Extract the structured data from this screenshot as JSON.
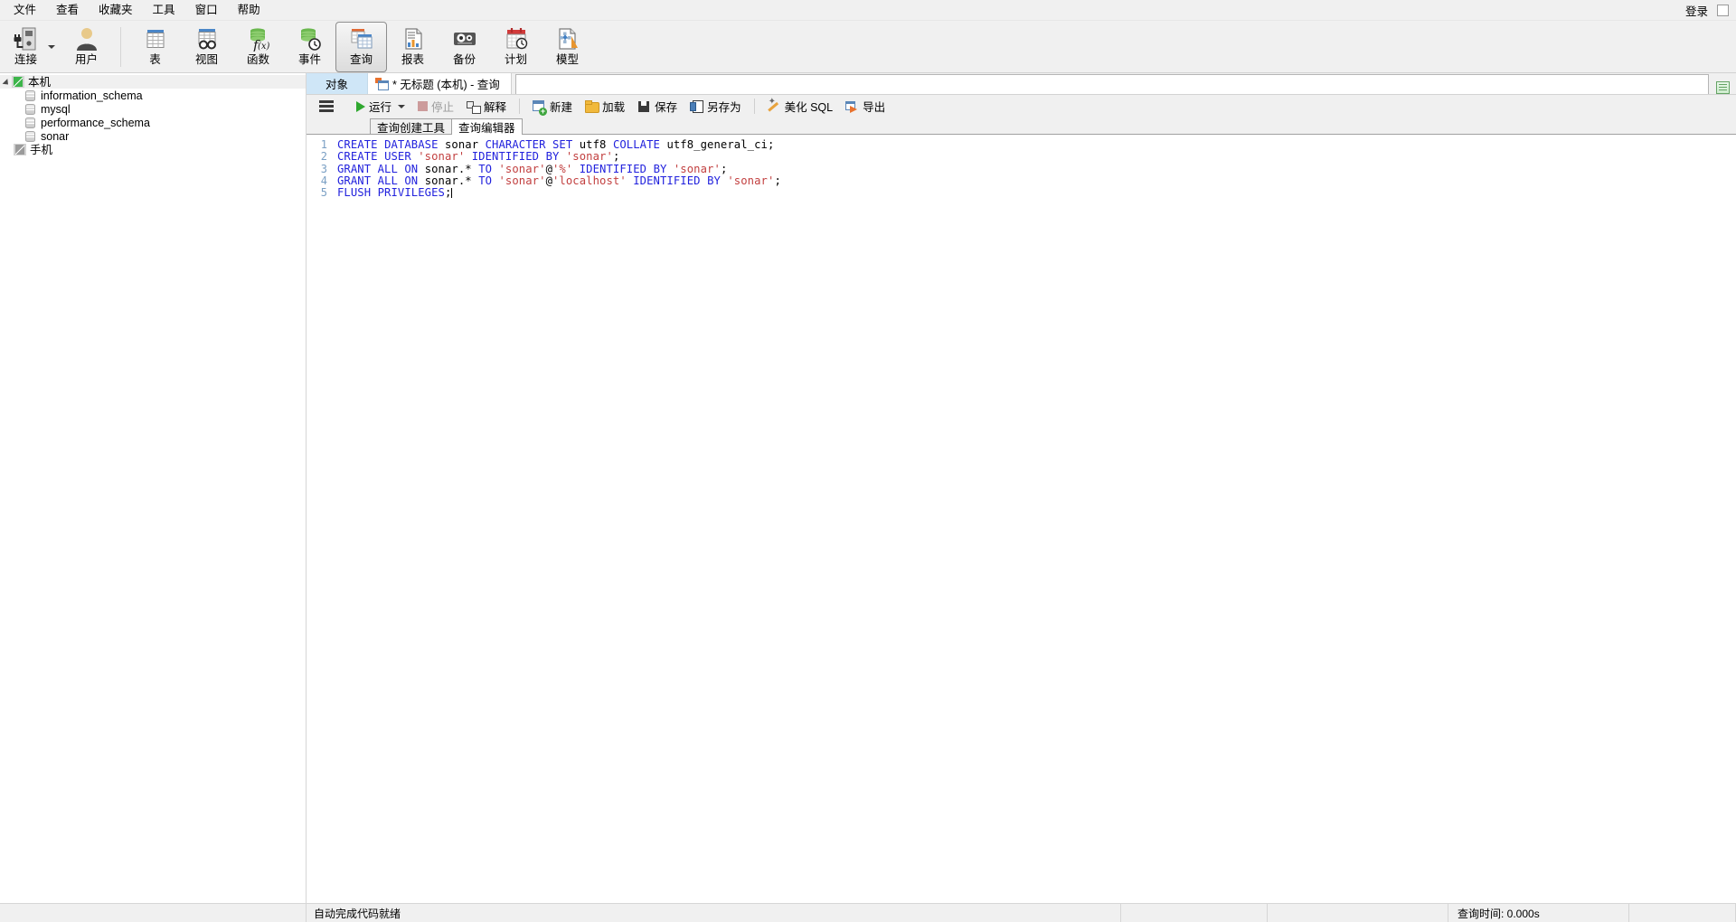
{
  "menu": {
    "items": [
      {
        "label": "文件",
        "name": "menu-file"
      },
      {
        "label": "查看",
        "name": "menu-view"
      },
      {
        "label": "收藏夹",
        "name": "menu-favorites"
      },
      {
        "label": "工具",
        "name": "menu-tools"
      },
      {
        "label": "窗口",
        "name": "menu-window"
      },
      {
        "label": "帮助",
        "name": "menu-help"
      }
    ],
    "login_label": "登录"
  },
  "ribbon": {
    "group1": [
      {
        "label": "连接",
        "icon": "connection-icon",
        "has_dropdown": true
      },
      {
        "label": "用户",
        "icon": "user-icon",
        "has_dropdown": false
      }
    ],
    "group2": [
      {
        "label": "表",
        "icon": "table-icon",
        "active": false
      },
      {
        "label": "视图",
        "icon": "view-icon",
        "active": false
      },
      {
        "label": "函数",
        "icon": "function-icon",
        "active": false
      },
      {
        "label": "事件",
        "icon": "event-icon",
        "active": false
      },
      {
        "label": "查询",
        "icon": "query-icon",
        "active": true
      },
      {
        "label": "报表",
        "icon": "report-icon",
        "active": false
      },
      {
        "label": "备份",
        "icon": "backup-icon",
        "active": false
      },
      {
        "label": "计划",
        "icon": "schedule-icon",
        "active": false
      },
      {
        "label": "模型",
        "icon": "model-icon",
        "active": false
      }
    ]
  },
  "sidebar": {
    "tree": [
      {
        "label": "本机",
        "type": "connection",
        "state": "connected",
        "level": 0,
        "expanded": true,
        "selected": true
      },
      {
        "label": "information_schema",
        "type": "database",
        "level": 1
      },
      {
        "label": "mysql",
        "type": "database",
        "level": 1
      },
      {
        "label": "performance_schema",
        "type": "database",
        "level": 1
      },
      {
        "label": "sonar",
        "type": "database",
        "level": 1
      },
      {
        "label": "手机",
        "type": "connection",
        "state": "disconnected",
        "level": 0,
        "expanded": false
      }
    ]
  },
  "tabs": {
    "object_tab": "对象",
    "query_tab": "* 无标题 (本机) - 查询"
  },
  "query_toolbar": {
    "menu_button": "list-menu-icon",
    "buttons": [
      {
        "label": "运行",
        "icon": "play-icon",
        "disabled": false,
        "dropdown": true
      },
      {
        "label": "停止",
        "icon": "stop-icon",
        "disabled": true,
        "dropdown": false
      },
      {
        "label": "解释",
        "icon": "explain-icon",
        "disabled": false,
        "dropdown": false
      },
      {
        "label": "新建",
        "icon": "new-query-icon",
        "disabled": false,
        "dropdown": false
      },
      {
        "label": "加载",
        "icon": "open-folder-icon",
        "disabled": false,
        "dropdown": false
      },
      {
        "label": "保存",
        "icon": "save-disk-icon",
        "disabled": false,
        "dropdown": false
      },
      {
        "label": "另存为",
        "icon": "save-as-icon",
        "disabled": false,
        "dropdown": false
      },
      {
        "label": "美化 SQL",
        "icon": "magic-wand-icon",
        "disabled": false,
        "dropdown": false
      },
      {
        "label": "导出",
        "icon": "export-icon",
        "disabled": false,
        "dropdown": false
      }
    ]
  },
  "subtabs": [
    {
      "label": "查询创建工具",
      "active": false
    },
    {
      "label": "查询编辑器",
      "active": true
    }
  ],
  "editor": {
    "line_numbers": [
      "1",
      "2",
      "3",
      "4",
      "5"
    ],
    "lines": [
      "CREATE DATABASE sonar CHARACTER SET utf8 COLLATE utf8_general_ci;",
      "CREATE USER 'sonar' IDENTIFIED BY 'sonar';",
      "GRANT ALL ON sonar.* TO 'sonar'@'%' IDENTIFIED BY 'sonar';",
      "GRANT ALL ON sonar.* TO 'sonar'@'localhost' IDENTIFIED BY 'sonar';",
      "FLUSH PRIVILEGES;"
    ],
    "tokens": [
      [
        {
          "t": "CREATE ",
          "c": "kw"
        },
        {
          "t": "DATABASE ",
          "c": "kw"
        },
        {
          "t": "sonar ",
          "c": "id"
        },
        {
          "t": "CHARACTER ",
          "c": "kw"
        },
        {
          "t": "SET ",
          "c": "kw"
        },
        {
          "t": "utf8 ",
          "c": "id"
        },
        {
          "t": "COLLATE ",
          "c": "kw"
        },
        {
          "t": "utf8_general_ci;",
          "c": "id"
        }
      ],
      [
        {
          "t": "CREATE ",
          "c": "kw"
        },
        {
          "t": "USER ",
          "c": "kw"
        },
        {
          "t": "'sonar' ",
          "c": "str"
        },
        {
          "t": "IDENTIFIED ",
          "c": "kw"
        },
        {
          "t": "BY ",
          "c": "kw"
        },
        {
          "t": "'sonar'",
          "c": "str"
        },
        {
          "t": ";",
          "c": "pun"
        }
      ],
      [
        {
          "t": "GRANT ",
          "c": "kw"
        },
        {
          "t": "ALL ",
          "c": "kw"
        },
        {
          "t": "ON ",
          "c": "kw"
        },
        {
          "t": "sonar.* ",
          "c": "id"
        },
        {
          "t": "TO ",
          "c": "kw"
        },
        {
          "t": "'sonar'",
          "c": "str"
        },
        {
          "t": "@",
          "c": "pun"
        },
        {
          "t": "'%' ",
          "c": "str"
        },
        {
          "t": "IDENTIFIED ",
          "c": "kw"
        },
        {
          "t": "BY ",
          "c": "kw"
        },
        {
          "t": "'sonar'",
          "c": "str"
        },
        {
          "t": ";",
          "c": "pun"
        }
      ],
      [
        {
          "t": "GRANT ",
          "c": "kw"
        },
        {
          "t": "ALL ",
          "c": "kw"
        },
        {
          "t": "ON ",
          "c": "kw"
        },
        {
          "t": "sonar.* ",
          "c": "id"
        },
        {
          "t": "TO ",
          "c": "kw"
        },
        {
          "t": "'sonar'",
          "c": "str"
        },
        {
          "t": "@",
          "c": "pun"
        },
        {
          "t": "'localhost' ",
          "c": "str"
        },
        {
          "t": "IDENTIFIED ",
          "c": "kw"
        },
        {
          "t": "BY ",
          "c": "kw"
        },
        {
          "t": "'sonar'",
          "c": "str"
        },
        {
          "t": ";",
          "c": "pun"
        }
      ],
      [
        {
          "t": "FLUSH ",
          "c": "kw"
        },
        {
          "t": "PRIVILEGES",
          "c": "kw"
        },
        {
          "t": ";",
          "c": "pun"
        }
      ]
    ]
  },
  "statusbar": {
    "message": "自动完成代码就绪",
    "cell1": "",
    "cell2": "",
    "query_time": "查询时间: 0.000s",
    "cell4": ""
  }
}
